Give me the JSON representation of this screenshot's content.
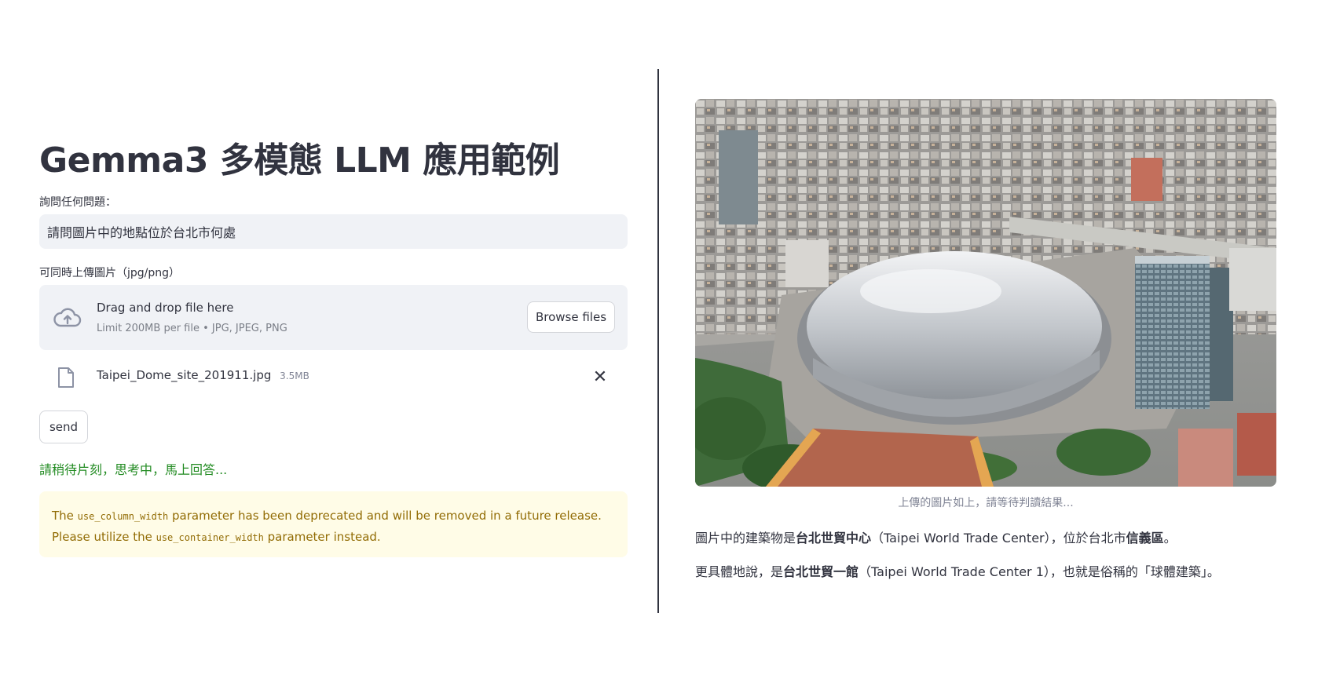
{
  "app": {
    "title": "Gemma3 多模態 LLM 應用範例"
  },
  "question": {
    "label": "詢問任何問題：",
    "value": "請問圖片中的地點位於台北市何處"
  },
  "uploader": {
    "label": "可同時上傳圖片（jpg/png）",
    "drag_text": "Drag and drop file here",
    "limit_text": "Limit 200MB per file • JPG, JPEG, PNG",
    "browse_label": "Browse files",
    "file_name": "Taipei_Dome_site_201911.jpg",
    "file_size": "3.5MB"
  },
  "send_label": "send",
  "status_text": "請稍待片刻，思考中，馬上回答...",
  "warning": {
    "pre": "The ",
    "code1": "use_column_width",
    "mid": " parameter has been deprecated and will be removed in a future release. Please utilize the ",
    "code2": "use_container_width",
    "post": " parameter instead."
  },
  "image_caption": "上傳的圖片如上，請等待判讀結果...",
  "answer": {
    "line1_pre": "圖片中的建築物是",
    "line1_bold1": "台北世貿中心",
    "line1_mid": "（Taipei World Trade Center），位於台北市",
    "line1_bold2": "信義區",
    "line1_post": "。",
    "line2_pre": "更具體地說，是",
    "line2_bold": "台北世貿一館",
    "line2_post": "（Taipei World Trade Center 1），也就是俗稱的「球體建築」。"
  },
  "colors": {
    "status_green": "#228b22",
    "warning_bg": "#fffce7",
    "warning_text": "#926c05",
    "input_bg": "#f0f2f6"
  },
  "icons": [
    "cloud-upload-icon",
    "file-icon",
    "close-icon"
  ]
}
